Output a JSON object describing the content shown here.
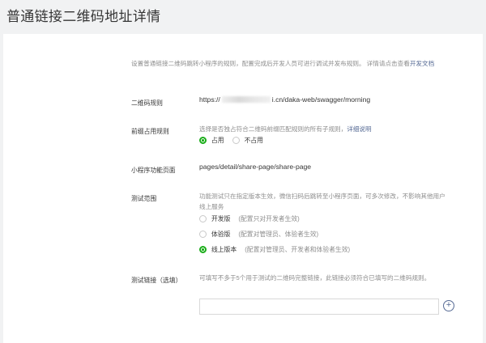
{
  "page": {
    "title": "普通链接二维码地址详情"
  },
  "intro": {
    "text": "设置普通链接二维码跳转小程序的规则，配置完成后开发人员可进行调试并发布规则。 详情请点击查看",
    "link": "开发文档"
  },
  "qr_rule": {
    "label": "二维码规则",
    "prefix": "https://",
    "suffix": "i.cn/daka-web/swagger/morning"
  },
  "prefix_rule": {
    "label": "前缀占用规则",
    "desc": "选择是否独占符合二维码前缀匹配规则的所有子规则，",
    "desc_link": "详细说明",
    "options": [
      {
        "label": "占用",
        "selected": true
      },
      {
        "label": "不占用",
        "selected": false
      }
    ]
  },
  "mini_page": {
    "label": "小程序功能页面",
    "value": "pages/detail/share-page/share-page"
  },
  "test_scope": {
    "label": "测试范围",
    "desc": "功能测试只在指定版本生效，微信扫码后跳转至小程序页面，可多次修改，不影响其他用户线上服务",
    "options": [
      {
        "label": "开发版",
        "note": "(配置只对开发者生效)",
        "selected": false
      },
      {
        "label": "体验版",
        "note": "(配置对管理员、体验者生效)",
        "selected": false
      },
      {
        "label": "线上版本",
        "note": "(配置对管理员、开发者和体验者生效)",
        "selected": true
      }
    ]
  },
  "test_link": {
    "label": "测试链接（选填）",
    "desc": "可填写不多于5个用于测试的二维码完整链接，此链接必须符合已填写的二维码规则。",
    "input_value": "",
    "add_symbol": "+"
  }
}
